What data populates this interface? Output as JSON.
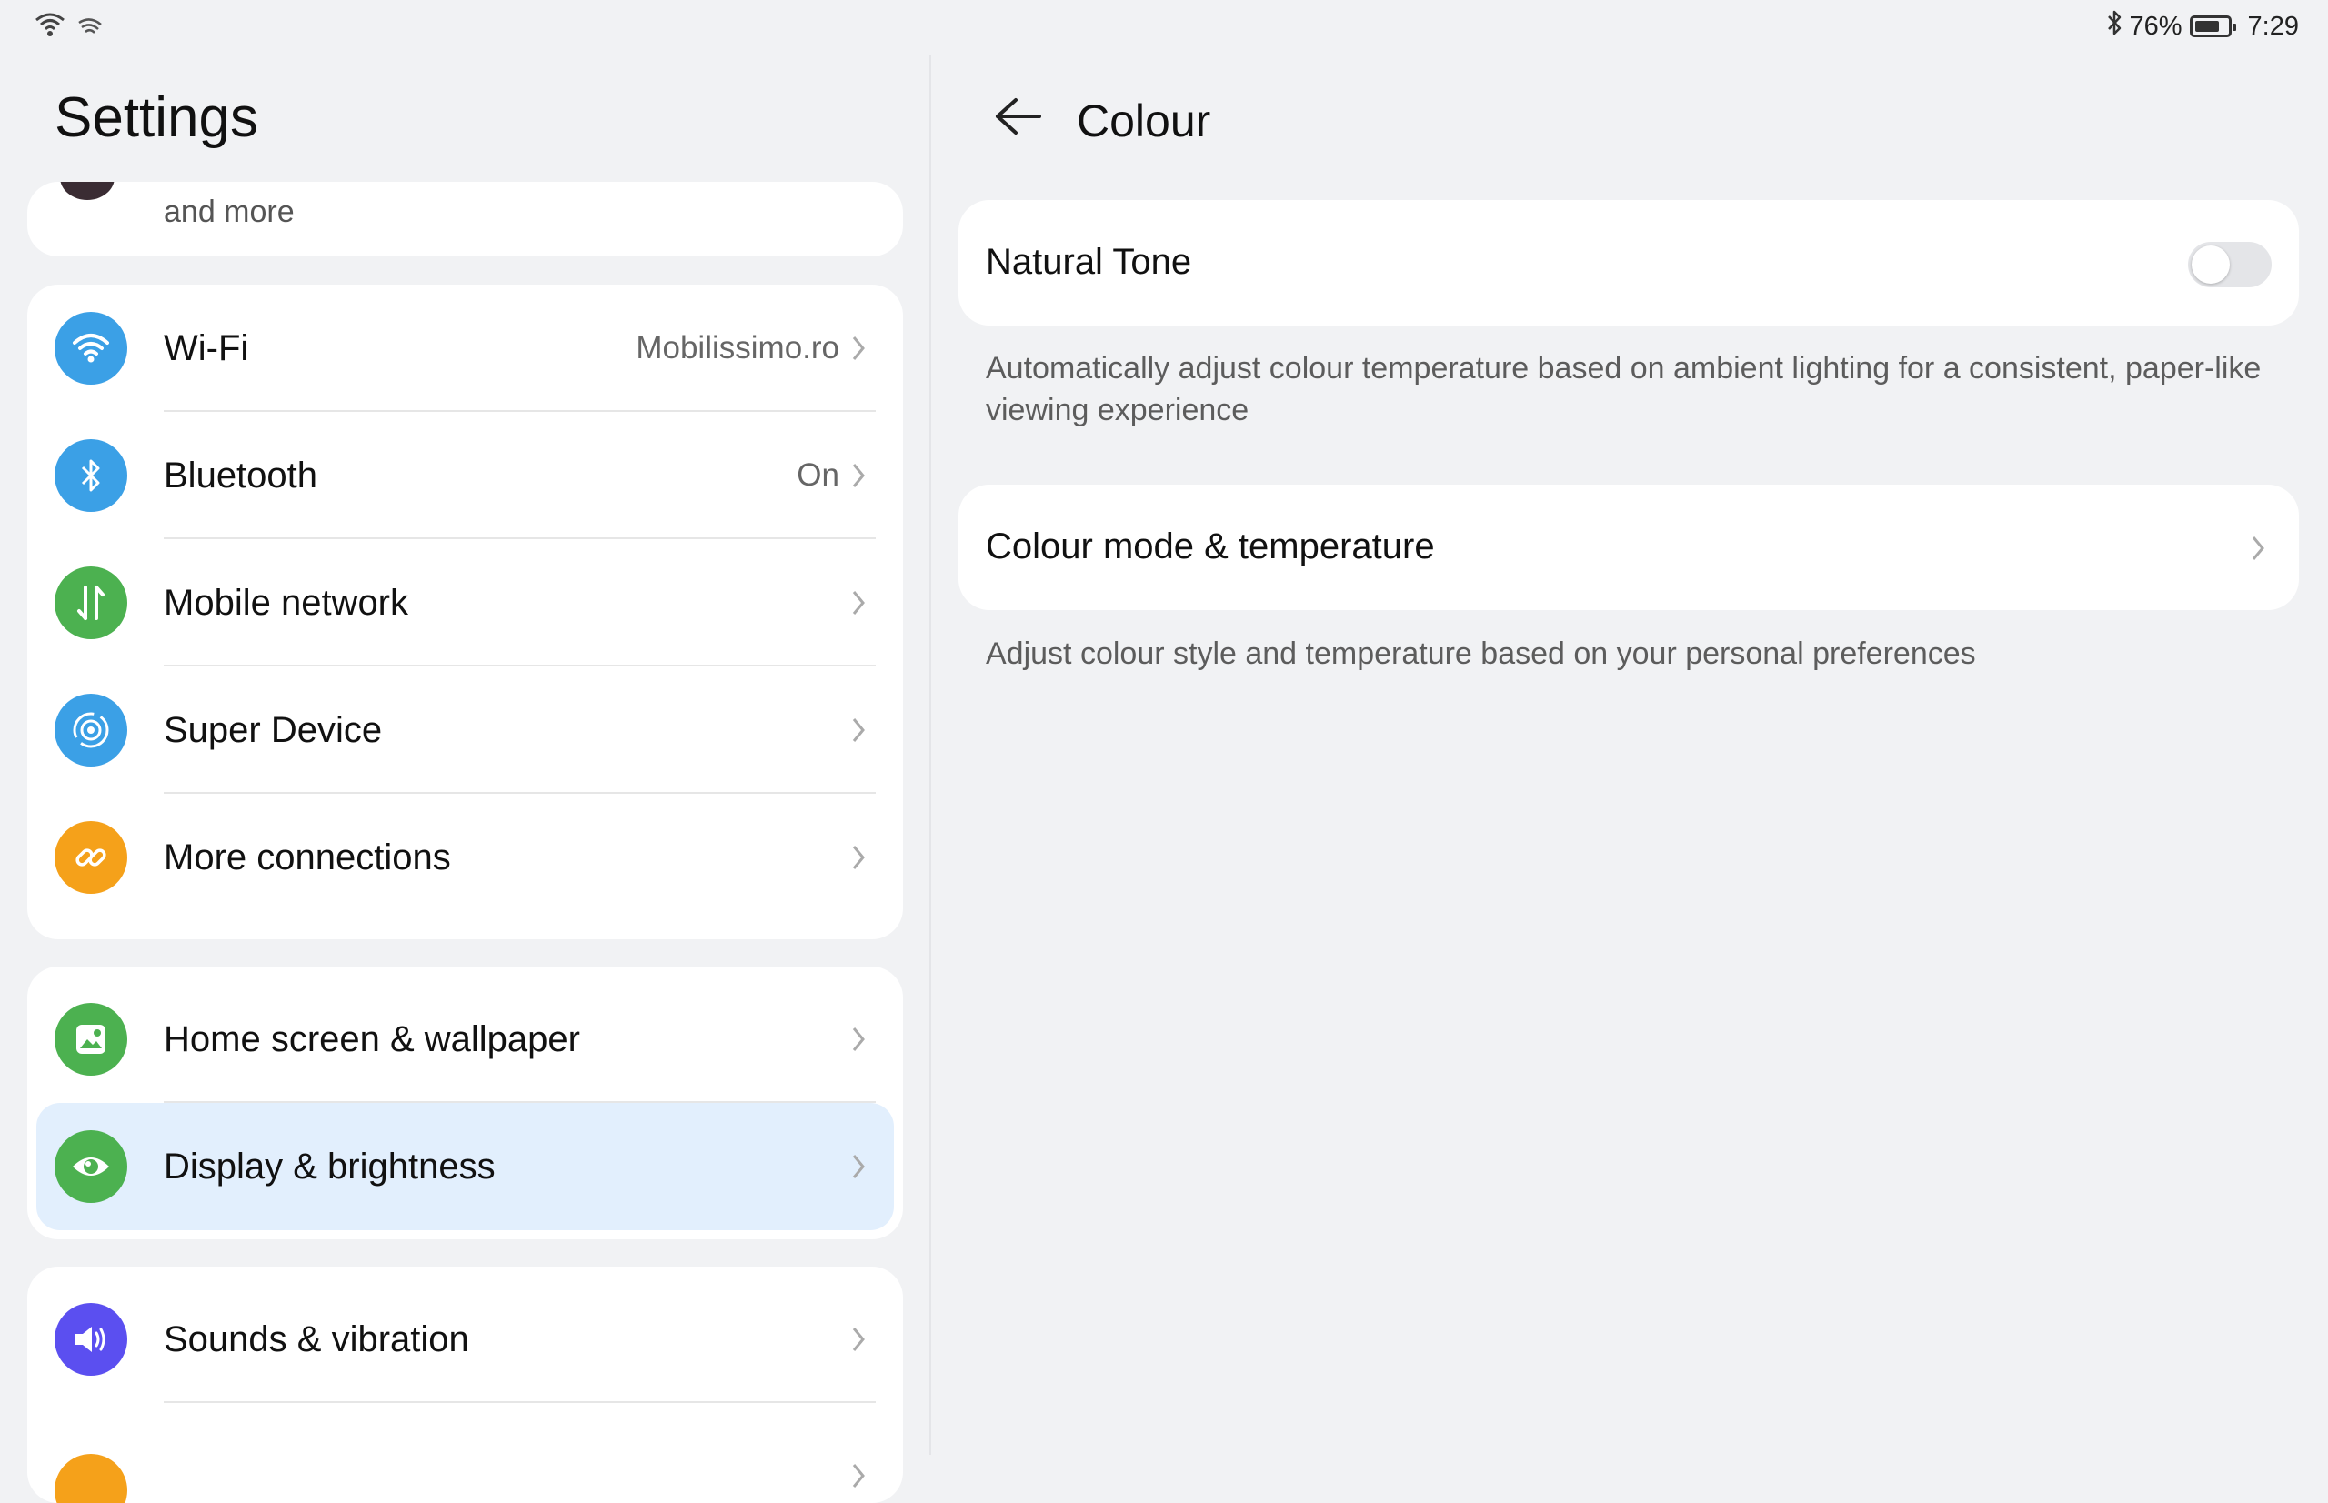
{
  "status_bar": {
    "signal_icon": "wifi-signal-icon",
    "extra_icon": "hotspot-icon",
    "bluetooth_icon": "bluetooth-icon",
    "battery_percent": "76%",
    "battery_level": 0.76,
    "time": "7:29"
  },
  "left": {
    "title": "Settings",
    "account_subtext": "and more",
    "connectivity": [
      {
        "label": "Wi-Fi",
        "value": "Mobilissimo.ro",
        "icon": "wifi-icon",
        "color": "#3ba0e6"
      },
      {
        "label": "Bluetooth",
        "value": "On",
        "icon": "bluetooth-icon",
        "color": "#3ba0e6"
      },
      {
        "label": "Mobile network",
        "value": "",
        "icon": "mobile-data-icon",
        "color": "#4cb150"
      },
      {
        "label": "Super Device",
        "value": "",
        "icon": "super-device-icon",
        "color": "#3ba0e6"
      },
      {
        "label": "More connections",
        "value": "",
        "icon": "link-icon",
        "color": "#f5a11a"
      }
    ],
    "personalization": [
      {
        "label": "Home screen & wallpaper",
        "icon": "wallpaper-icon",
        "color": "#4cb150"
      },
      {
        "label": "Display & brightness",
        "icon": "eye-icon",
        "color": "#4cb150",
        "selected": true
      }
    ],
    "sound": [
      {
        "label": "Sounds & vibration",
        "icon": "speaker-icon",
        "color": "#5b4ff0"
      }
    ]
  },
  "right": {
    "title": "Colour",
    "natural_tone": {
      "label": "Natural Tone",
      "enabled": false,
      "description": "Automatically adjust colour temperature based on ambient lighting for a consistent, paper-like viewing experience"
    },
    "colour_mode": {
      "label": "Colour mode & temperature",
      "description": "Adjust colour style and temperature based on your personal preferences"
    }
  },
  "colors": {
    "background": "#f1f2f4",
    "card": "#ffffff",
    "selected_row": "#e2effd"
  }
}
